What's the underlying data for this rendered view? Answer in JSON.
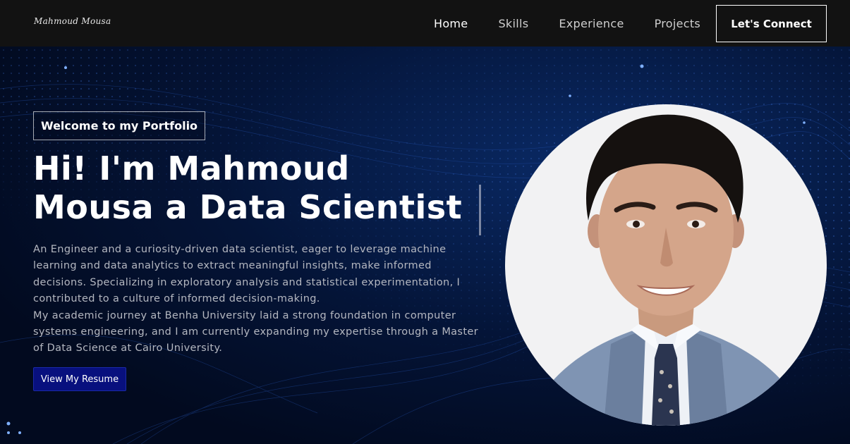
{
  "nav": {
    "logo": "Mahmoud Mousa",
    "links": [
      "Home",
      "Skills",
      "Experience",
      "Projects"
    ],
    "connect_label": "Let's Connect"
  },
  "hero": {
    "welcome": "Welcome to my Portfolio",
    "headline_line1": "Hi! I'm Mahmoud",
    "headline_line2": "Mousa a Data Scientist",
    "bio_1": "An Engineer and a curiosity-driven data scientist, eager to leverage machine learning and data analytics to extract meaningful insights, make informed decisions. Specializing in exploratory analysis and statistical experimentation, I contributed to a culture of informed decision-making.",
    "bio_2": "My academic journey at Benha University laid a strong foundation in computer systems engineering, and I am currently expanding my expertise through a Master of Data Science at Cairo University.",
    "resume_label": "View My Resume"
  },
  "colors": {
    "navbar": "#121212",
    "hero_background": "#020a1f",
    "resume_button": "#08107e",
    "avatar_background": "#f2f2f3"
  },
  "icons": {
    "profile_photo": "portrait-photo"
  }
}
